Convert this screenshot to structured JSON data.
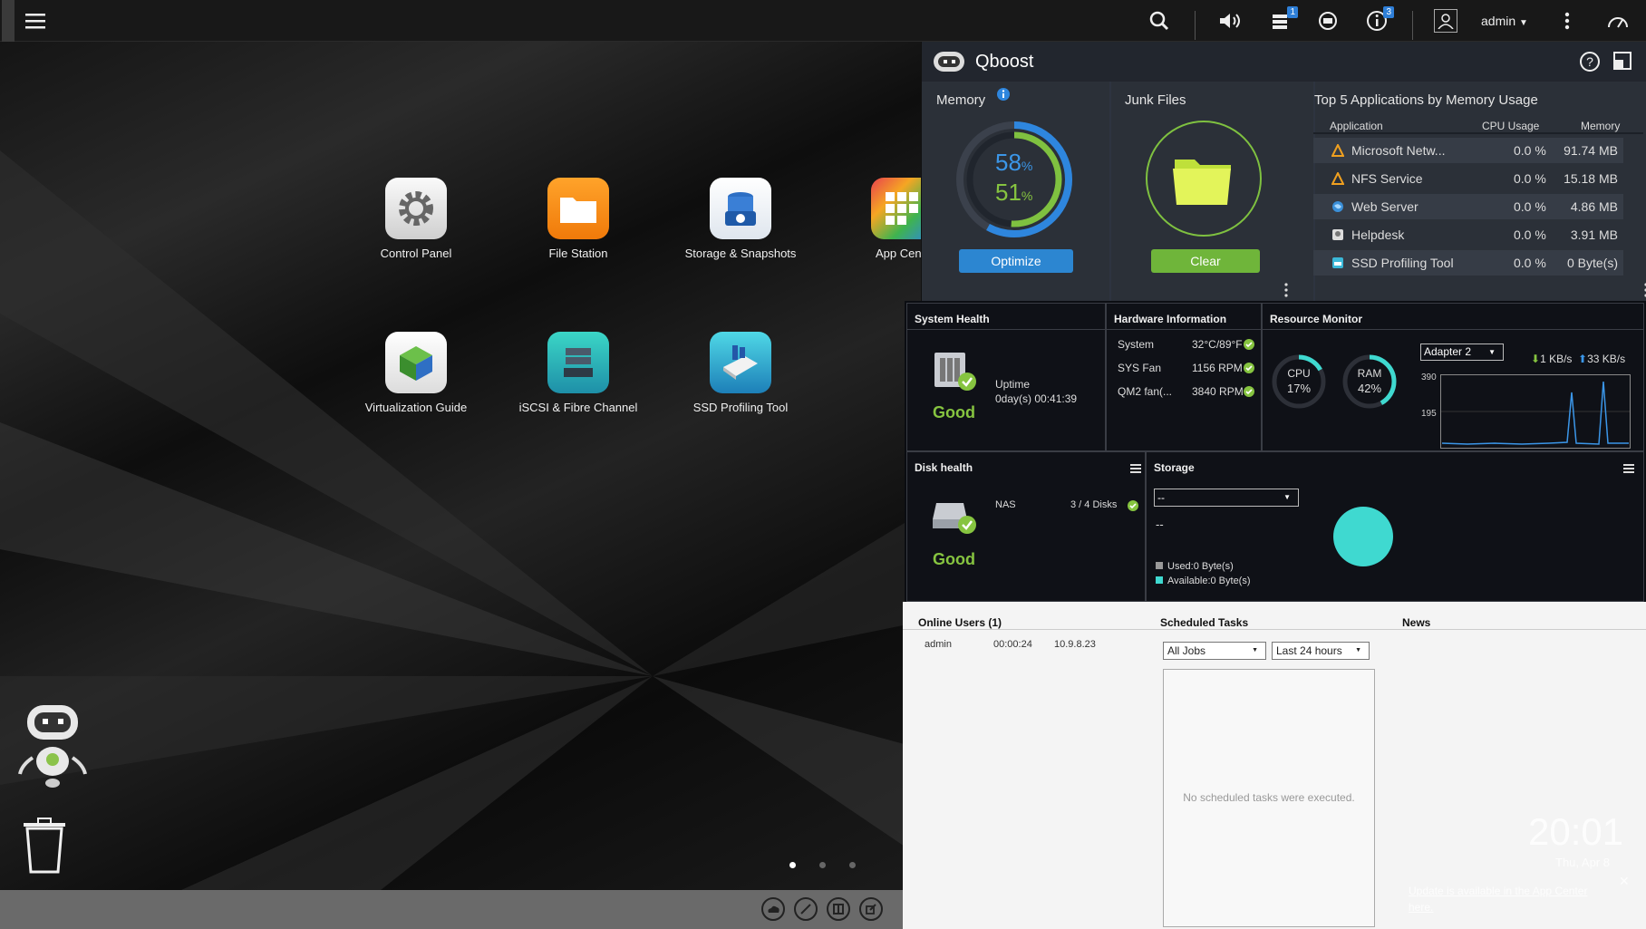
{
  "user": "admin",
  "badges": {
    "tasks": "1",
    "info": "3"
  },
  "desktop": {
    "apps": [
      {
        "label": "Control Panel",
        "icon": "control-panel-gear-icon"
      },
      {
        "label": "File Station",
        "icon": "file-station-folder-icon"
      },
      {
        "label": "Storage & Snapshots",
        "icon": "storage-snapshots-icon"
      },
      {
        "label": "App Cent",
        "icon": "app-center-icon"
      },
      {
        "label": "Virtualization Guide",
        "icon": "virtualization-guide-icon"
      },
      {
        "label": "iSCSI & Fibre Channel",
        "icon": "iscsi-icon"
      },
      {
        "label": "SSD Profiling Tool",
        "icon": "ssd-profiling-icon"
      }
    ]
  },
  "qboost": {
    "title": "Qboost",
    "memory": {
      "label": "Memory",
      "outer_pct": "58",
      "inner_pct": "51",
      "pct_sign": "%",
      "button": "Optimize"
    },
    "junk": {
      "label": "Junk Files",
      "button": "Clear"
    },
    "top5": {
      "title": "Top 5 Applications by Memory Usage",
      "headers": [
        "Application",
        "CPU Usage",
        "Memory"
      ],
      "rows": [
        {
          "app": "Microsoft Netw...",
          "cpu": "0.0 %",
          "mem": "91.74 MB"
        },
        {
          "app": "NFS Service",
          "cpu": "0.0 %",
          "mem": "15.18 MB"
        },
        {
          "app": "Web Server",
          "cpu": "0.0 %",
          "mem": "4.86 MB"
        },
        {
          "app": "Helpdesk",
          "cpu": "0.0 %",
          "mem": "3.91 MB"
        },
        {
          "app": "SSD Profiling Tool",
          "cpu": "0.0 %",
          "mem": "0 Byte(s)"
        }
      ]
    }
  },
  "system_health": {
    "title": "System Health",
    "status": "Good",
    "uptime_label": "Uptime",
    "uptime": "0day(s) 00:41:39"
  },
  "hardware": {
    "title": "Hardware Information",
    "rows": [
      {
        "label": "System",
        "value": "32°C/89°F"
      },
      {
        "label": "SYS Fan",
        "value": "1156 RPM"
      },
      {
        "label": "QM2 fan(...",
        "value": "3840 RPM"
      }
    ]
  },
  "resource": {
    "title": "Resource Monitor",
    "cpu_label": "CPU",
    "cpu": "17%",
    "cpu_frac": 0.17,
    "ram_label": "RAM",
    "ram": "42%",
    "ram_frac": 0.42,
    "adapter": "Adapter 2",
    "down": "1 KB/s",
    "up": "33 KB/s",
    "y_top": "390",
    "y_mid": "195"
  },
  "disk": {
    "title": "Disk health",
    "device": "NAS",
    "disks": "3 / 4 Disks",
    "status": "Good"
  },
  "storage": {
    "title": "Storage",
    "select": "--",
    "value": "--",
    "used": "Used:0 Byte(s)",
    "available": "Available:0 Byte(s)"
  },
  "online": {
    "title": "Online Users (1)",
    "user": "admin",
    "time": "00:00:24",
    "ip": "10.9.8.23"
  },
  "tasks": {
    "title": "Scheduled Tasks",
    "filter1": "All Jobs",
    "filter2": "Last 24 hours",
    "empty": "No scheduled tasks were executed."
  },
  "news": {
    "title": "News",
    "update": "Update is available in the App Center",
    "link": "here."
  },
  "clock": {
    "time": "20:01",
    "date": "Thu, Apr 8"
  }
}
